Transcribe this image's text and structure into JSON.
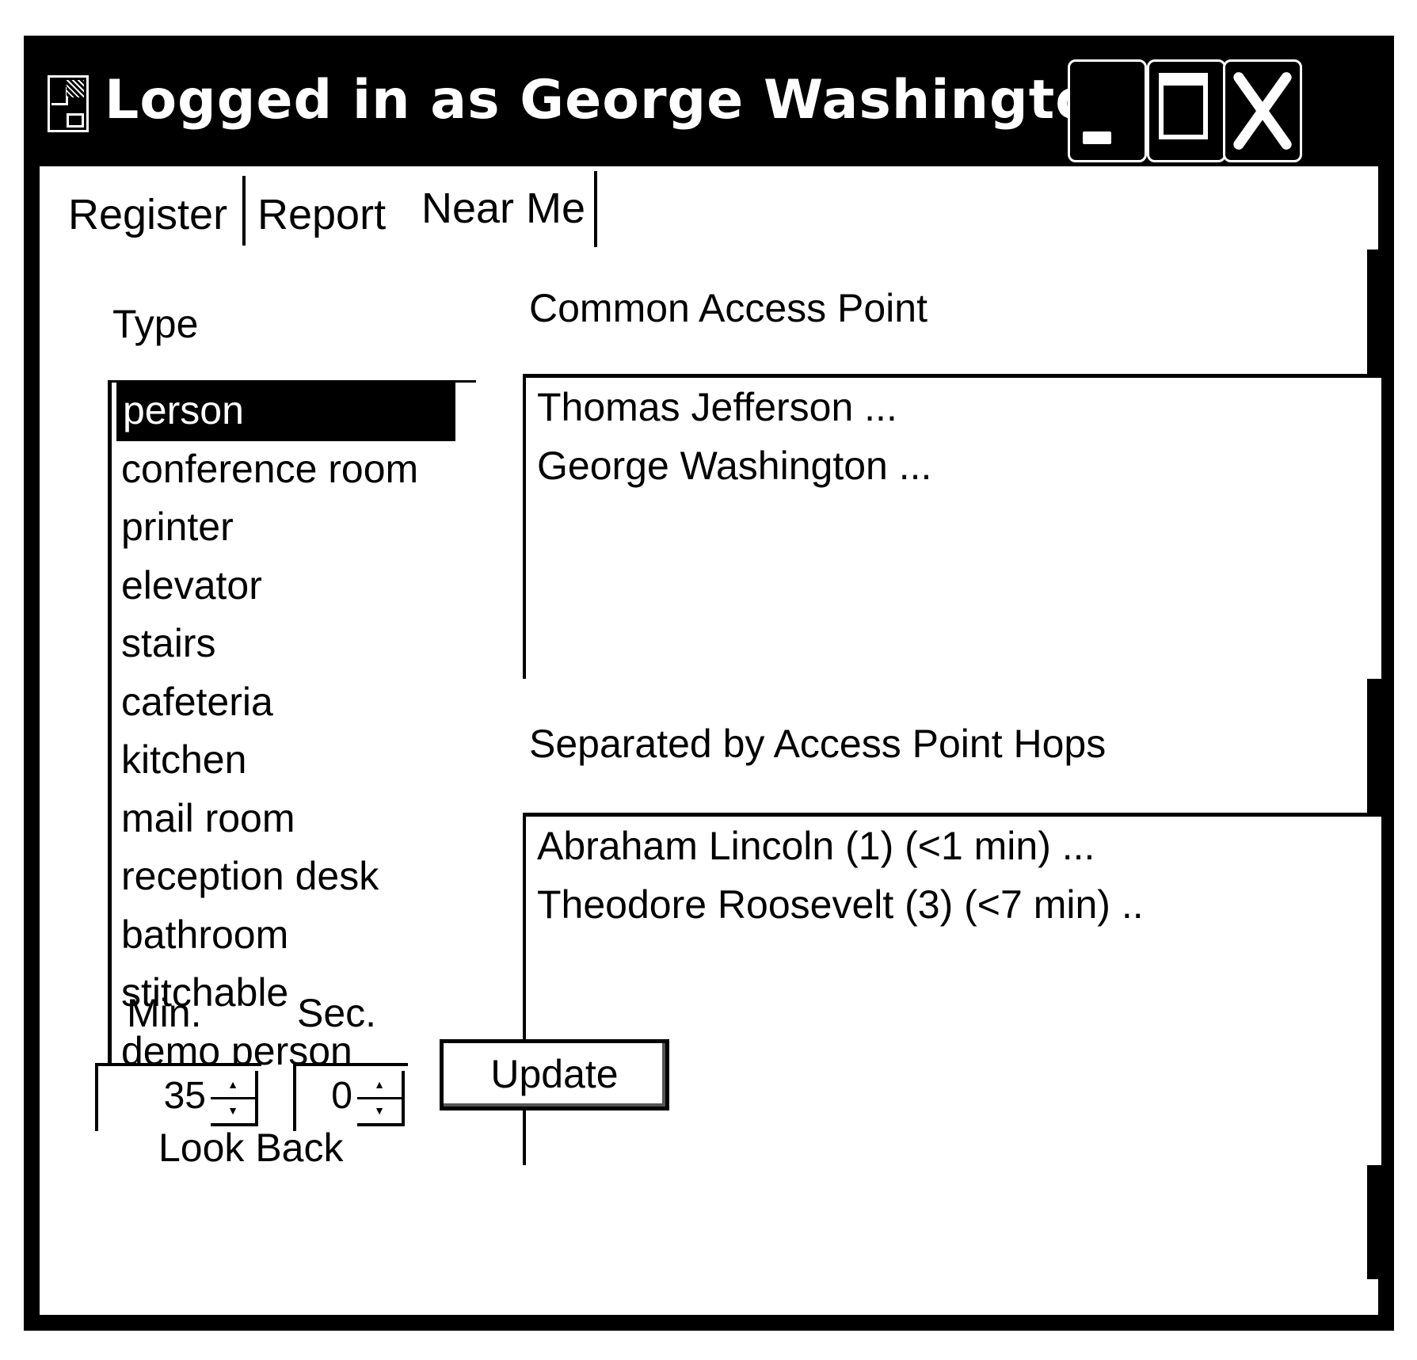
{
  "window": {
    "title": "Logged in as George Washington",
    "controls": {
      "minimize": "minimize",
      "maximize": "maximize",
      "close": "close"
    }
  },
  "tabs": [
    {
      "label": "Register",
      "active": false
    },
    {
      "label": "Report",
      "active": false
    },
    {
      "label": "Near Me",
      "active": true
    }
  ],
  "type_panel": {
    "label": "Type",
    "items": [
      "person",
      "conference room",
      "printer",
      "elevator",
      "stairs",
      "cafeteria",
      "kitchen",
      "mail room",
      "reception desk",
      "bathroom",
      "stitchable",
      "demo person"
    ],
    "selected": "person"
  },
  "common_access_point": {
    "label": "Common Access Point",
    "entries": [
      "Thomas Jefferson ...",
      "George Washington ..."
    ]
  },
  "access_point_hops": {
    "label": "Separated by Access Point Hops",
    "entries": [
      "Abraham Lincoln (1) (<1 min) ...",
      "Theodore Roosevelt (3) (<7 min) .."
    ]
  },
  "look_back": {
    "label": "Look Back",
    "min_label": "Min.",
    "sec_label": "Sec.",
    "min_value": "35",
    "sec_value": "0"
  },
  "update_button": {
    "label": "Update"
  }
}
